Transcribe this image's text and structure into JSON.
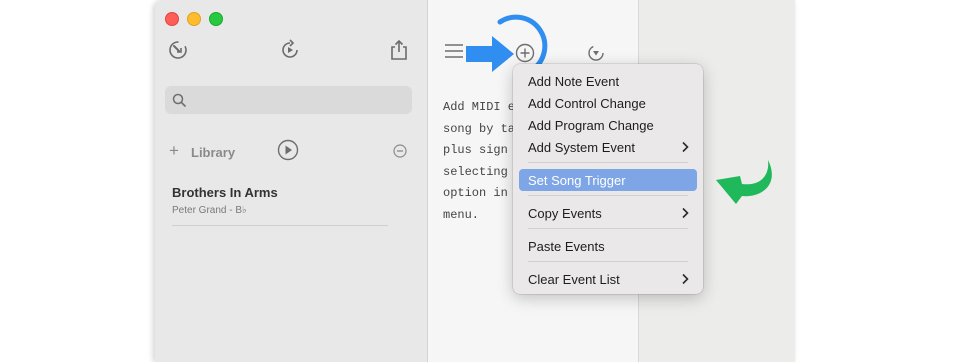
{
  "colors": {
    "accent_blue": "#2f8ef0",
    "accent_green": "#1fb85b",
    "menu_highlight": "#7ea6e6"
  },
  "toolbar": {
    "icons": [
      "song-tempo-icon",
      "loop-refresh-icon",
      "share-icon"
    ]
  },
  "search": {
    "placeholder": "",
    "value": ""
  },
  "library": {
    "label": "Library",
    "add_icon": "+"
  },
  "song": {
    "title": "Brothers In Arms",
    "subtitle": "Peter Grand - B♭"
  },
  "editor": {
    "help_text": "Add MIDI e\nsong by ta\nplus sign a\nselecting t\noption in t\nmenu."
  },
  "context_menu": {
    "items": [
      {
        "label": "Add Note Event",
        "submenu": false
      },
      {
        "label": "Add Control Change",
        "submenu": false
      },
      {
        "label": "Add Program Change",
        "submenu": false
      },
      {
        "label": "Add System Event",
        "submenu": true
      },
      {
        "label": "Set Song Trigger",
        "submenu": false,
        "selected": true
      },
      {
        "label": "Copy Events",
        "submenu": true
      },
      {
        "label": "Paste Events",
        "submenu": false
      },
      {
        "label": "Clear Event List",
        "submenu": true
      }
    ]
  }
}
